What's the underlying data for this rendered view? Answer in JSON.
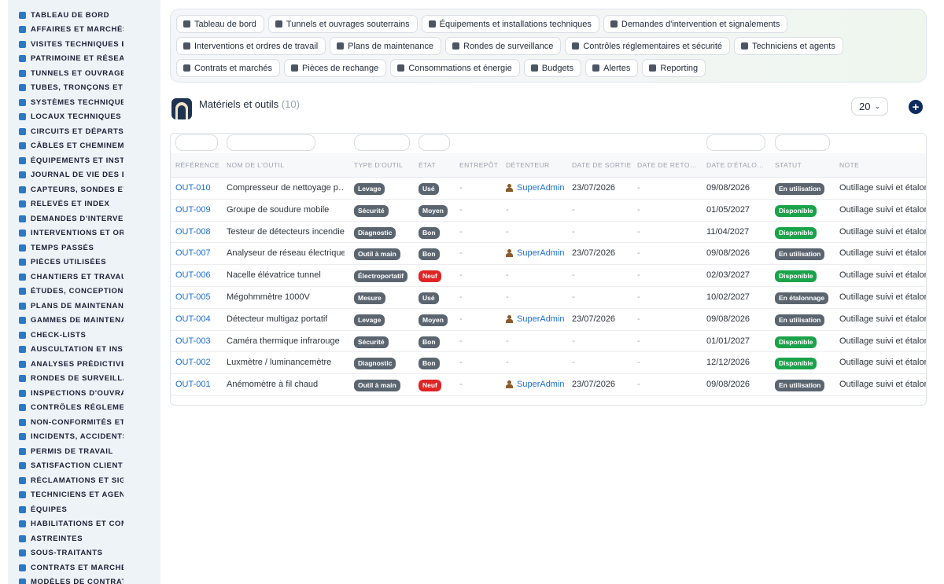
{
  "sidebar": {
    "items": [
      {
        "label": "Tableau de bord",
        "icon": "dashboard-icon"
      },
      {
        "label": "Affaires et marchés",
        "icon": "target-icon"
      },
      {
        "label": "Visites techniques et",
        "icon": "walk-icon"
      },
      {
        "label": "Patrimoine et réseaux",
        "icon": "chart-icon"
      },
      {
        "label": "Tunnels et ouvrages",
        "icon": "building-icon"
      },
      {
        "label": "Tubes, tronçons et zones",
        "icon": "list-icon"
      },
      {
        "label": "Systèmes techniques",
        "icon": "sitemap-icon"
      },
      {
        "label": "Locaux techniques et",
        "icon": "grid-icon"
      },
      {
        "label": "Circuits et départs électriques",
        "icon": "circuit-icon"
      },
      {
        "label": "Câbles et cheminements",
        "icon": "cable-icon"
      },
      {
        "label": "Équipements et installations",
        "icon": "cogs-icon"
      },
      {
        "label": "Journal de vie des équipements",
        "icon": "history-icon"
      },
      {
        "label": "Capteurs, sondes et compteurs",
        "icon": "sensor-icon"
      },
      {
        "label": "Relevés et index",
        "icon": "table-icon"
      },
      {
        "label": "Demandes d'intervention",
        "icon": "question-icon"
      },
      {
        "label": "Interventions et ordres",
        "icon": "file-icon"
      },
      {
        "label": "Temps passés",
        "icon": "clock-icon"
      },
      {
        "label": "Pièces utilisées",
        "icon": "list-icon"
      },
      {
        "label": "Chantiers et travaux",
        "icon": "hammer-icon"
      },
      {
        "label": "Études, conception et",
        "icon": "pen-icon"
      },
      {
        "label": "Plans de maintenance",
        "icon": "calendar-icon"
      },
      {
        "label": "Gammes de maintenance",
        "icon": "list-icon"
      },
      {
        "label": "Check-lists",
        "icon": "checklist-icon"
      },
      {
        "label": "Auscultation et instrumentation",
        "icon": "stethoscope-icon"
      },
      {
        "label": "Analyses prédictives",
        "icon": "analytics-icon"
      },
      {
        "label": "Rondes de surveillance",
        "icon": "route-icon"
      },
      {
        "label": "Inspections d'ouvrages",
        "icon": "inspect-icon"
      },
      {
        "label": "Contrôles réglementaires",
        "icon": "file-check-icon"
      },
      {
        "label": "Non-conformités et actions",
        "icon": "alert-circle-icon"
      },
      {
        "label": "Incidents, accidents et",
        "icon": "warning-icon"
      },
      {
        "label": "Permis de travail",
        "icon": "permit-icon"
      },
      {
        "label": "Satisfaction client",
        "icon": "smile-icon"
      },
      {
        "label": "Réclamations et signalements",
        "icon": "comment-icon"
      },
      {
        "label": "Techniciens et agents",
        "icon": "helmet-icon"
      },
      {
        "label": "Équipes",
        "icon": "users-icon"
      },
      {
        "label": "Habilitations et compétences",
        "icon": "certificate-icon"
      },
      {
        "label": "Astreintes",
        "icon": "phone-icon"
      },
      {
        "label": "Sous-traitants",
        "icon": "handshake-icon"
      },
      {
        "label": "Contrats et marchés",
        "icon": "contract-icon"
      },
      {
        "label": "Modèles de contrats",
        "icon": "template-icon"
      }
    ]
  },
  "topnav": {
    "pills": [
      {
        "label": "Tableau de bord",
        "icon": "dashboard-icon"
      },
      {
        "label": "Tunnels et ouvrages souterrains",
        "icon": "building-icon"
      },
      {
        "label": "Équipements et installations techniques",
        "icon": "cogs-icon"
      },
      {
        "label": "Demandes d'intervention et signalements",
        "icon": "question-icon"
      },
      {
        "label": "Interventions et ordres de travail",
        "icon": "file-icon"
      },
      {
        "label": "Plans de maintenance",
        "icon": "calendar-icon"
      },
      {
        "label": "Rondes de surveillance",
        "icon": "route-icon"
      },
      {
        "label": "Contrôles réglementaires et sécurité",
        "icon": "file-check-icon"
      },
      {
        "label": "Techniciens et agents",
        "icon": "helmet-icon"
      },
      {
        "label": "Contrats et marchés",
        "icon": "contract-icon"
      },
      {
        "label": "Pièces de rechange",
        "icon": "sitemap-icon"
      },
      {
        "label": "Consommations et énergie",
        "icon": "bolt-icon"
      },
      {
        "label": "Budgets",
        "icon": "money-icon"
      },
      {
        "label": "Alertes",
        "icon": "bell-icon"
      },
      {
        "label": "Reporting",
        "icon": "pie-icon"
      }
    ]
  },
  "header": {
    "title": "Matériels et outils",
    "count": "(10)",
    "page_size": "20",
    "add_symbol": "+"
  },
  "table": {
    "columns": [
      "Référence",
      "Nom de l'outil",
      "Type d'outil",
      "État",
      "Entrepôt",
      "Détenteur",
      "Date de sortie",
      "Date de reto…",
      "Date d'étalo…",
      "Statut",
      "Note"
    ],
    "rows": [
      {
        "ref": "OUT-010",
        "name": "Compresseur de nettoyage p…",
        "type": "Levage",
        "state": "Usé",
        "warehouse": "-",
        "holder": "SuperAdmin",
        "out_date": "23/07/2026",
        "return_date": "-",
        "calib_date": "09/08/2026",
        "status": "En utilisation",
        "note": "Outillage suivi et étalonné"
      },
      {
        "ref": "OUT-009",
        "name": "Groupe de soudure mobile",
        "type": "Sécurité",
        "state": "Moyen",
        "warehouse": "-",
        "holder": "-",
        "out_date": "-",
        "return_date": "-",
        "calib_date": "01/05/2027",
        "status": "Disponible",
        "note": "Outillage suivi et étalonné"
      },
      {
        "ref": "OUT-008",
        "name": "Testeur de détecteurs incendie",
        "type": "Diagnostic",
        "state": "Bon",
        "warehouse": "-",
        "holder": "-",
        "out_date": "-",
        "return_date": "-",
        "calib_date": "11/04/2027",
        "status": "Disponible",
        "note": "Outillage suivi et étalonné"
      },
      {
        "ref": "OUT-007",
        "name": "Analyseur de réseau électrique",
        "type": "Outil à main",
        "state": "Bon",
        "warehouse": "-",
        "holder": "SuperAdmin",
        "out_date": "23/07/2026",
        "return_date": "-",
        "calib_date": "09/08/2026",
        "status": "En utilisation",
        "note": "Outillage suivi et étalonné"
      },
      {
        "ref": "OUT-006",
        "name": "Nacelle élévatrice tunnel",
        "type": "Électroportatif",
        "state": "Neuf",
        "warehouse": "-",
        "holder": "-",
        "out_date": "-",
        "return_date": "-",
        "calib_date": "02/03/2027",
        "status": "Disponible",
        "note": "Outillage suivi et étalonné"
      },
      {
        "ref": "OUT-005",
        "name": "Mégohmmètre 1000V",
        "type": "Mesure",
        "state": "Usé",
        "warehouse": "-",
        "holder": "-",
        "out_date": "-",
        "return_date": "-",
        "calib_date": "10/02/2027",
        "status": "En étalonnage",
        "note": "Outillage suivi et étalonné"
      },
      {
        "ref": "OUT-004",
        "name": "Détecteur multigaz portatif",
        "type": "Levage",
        "state": "Moyen",
        "warehouse": "-",
        "holder": "SuperAdmin",
        "out_date": "23/07/2026",
        "return_date": "-",
        "calib_date": "09/08/2026",
        "status": "En utilisation",
        "note": "Outillage suivi et étalonné"
      },
      {
        "ref": "OUT-003",
        "name": "Caméra thermique infrarouge",
        "type": "Sécurité",
        "state": "Bon",
        "warehouse": "-",
        "holder": "-",
        "out_date": "-",
        "return_date": "-",
        "calib_date": "01/01/2027",
        "status": "Disponible",
        "note": "Outillage suivi et étalonné"
      },
      {
        "ref": "OUT-002",
        "name": "Luxmètre / luminancemètre",
        "type": "Diagnostic",
        "state": "Bon",
        "warehouse": "-",
        "holder": "-",
        "out_date": "-",
        "return_date": "-",
        "calib_date": "12/12/2026",
        "status": "Disponible",
        "note": "Outillage suivi et étalonné"
      },
      {
        "ref": "OUT-001",
        "name": "Anémomètre à fil chaud",
        "type": "Outil à main",
        "state": "Neuf",
        "warehouse": "-",
        "holder": "SuperAdmin",
        "out_date": "23/07/2026",
        "return_date": "-",
        "calib_date": "09/08/2026",
        "status": "En utilisation",
        "note": "Outillage suivi et étalonné"
      }
    ]
  },
  "colors": {
    "accent": "#1c6fd1",
    "badge_gray": "#5b6570",
    "badge_red": "#e02424",
    "badge_green": "#1aa34a",
    "sidebar_bg": "#eef3f8",
    "sidebar_icon": "#2b78c5",
    "add_button": "#0d2b5c"
  }
}
